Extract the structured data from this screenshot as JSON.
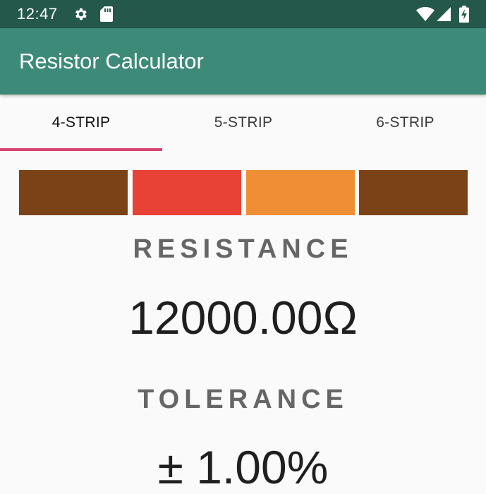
{
  "status_bar": {
    "time": "12:47",
    "icons": [
      "gear-icon",
      "sd-card-icon",
      "wifi-icon",
      "signal-icon",
      "battery-charging-icon"
    ]
  },
  "app_bar": {
    "title": "Resistor Calculator"
  },
  "tabs": [
    {
      "label": "4-STRIP",
      "selected": true
    },
    {
      "label": "5-STRIP",
      "selected": false
    },
    {
      "label": "6-STRIP",
      "selected": false
    }
  ],
  "colors": {
    "status_bar": "#23584b",
    "app_bar": "#3e8a78",
    "tab_indicator": "#d94470"
  },
  "bands": [
    {
      "name": "brown",
      "color": "#7b4218"
    },
    {
      "name": "red",
      "color": "#e84136"
    },
    {
      "name": "orange",
      "color": "#f08e35"
    },
    {
      "name": "brown",
      "color": "#7b4218"
    }
  ],
  "resistance": {
    "label": "RESISTANCE",
    "value": "12000.00Ω"
  },
  "tolerance": {
    "label": "TOLERANCE",
    "value": "± 1.00%"
  }
}
